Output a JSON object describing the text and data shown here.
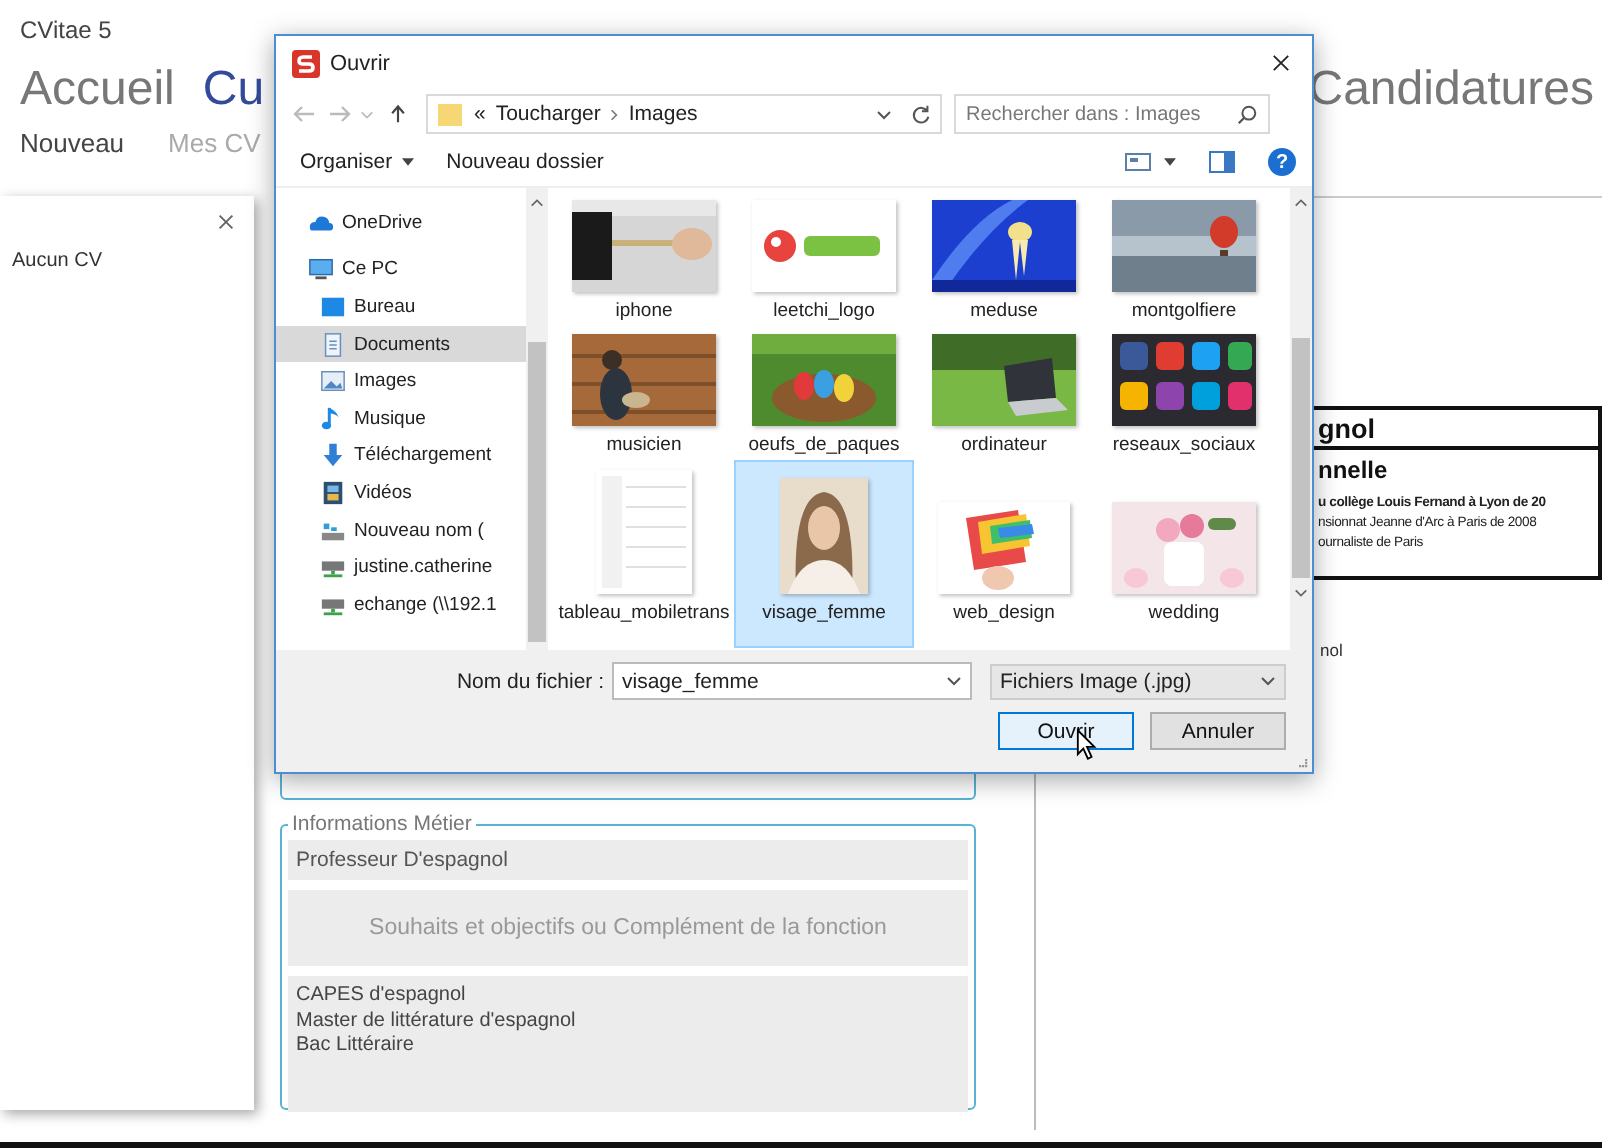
{
  "app": {
    "title": "CVitae 5",
    "nav": [
      {
        "label": "Accueil",
        "selected": false
      },
      {
        "label": "Cu",
        "selected": true
      },
      {
        "label": "Candidatures",
        "selected": false
      }
    ],
    "subnav": [
      {
        "label": "Nouveau",
        "selected": true
      },
      {
        "label": "Mes CV",
        "selected": false
      }
    ]
  },
  "cv_list": {
    "empty_text": "Aucun CV"
  },
  "form": {
    "legend": "Informations Métier",
    "job_title": "Professeur D'espagnol",
    "goals_placeholder": "Souhaits et objectifs ou Complément de la fonction",
    "diplomas": [
      "CAPES d'espagnol",
      "Master de littérature d'espagnol",
      "Bac Littéraire"
    ]
  },
  "preview": {
    "title": "gnol",
    "section_heading": "nnelle",
    "lines": [
      {
        "text": "u collège Louis Fernand à Lyon de 20",
        "bold": true
      },
      {
        "text": "nsionnat Jeanne d'Arc à Paris de 2008",
        "bold": false
      },
      {
        "text": "ournaliste de Paris",
        "bold": false
      }
    ],
    "footer_text": "nol"
  },
  "dialog": {
    "title": "Ouvrir",
    "path_prefix": "«",
    "path": [
      "Toucharger",
      "Images"
    ],
    "search_placeholder": "Rechercher dans : Images",
    "organize": "Organiser",
    "new_folder": "Nouveau dossier",
    "help": "?",
    "nav": [
      {
        "label": "OneDrive",
        "selected": false
      },
      {
        "label": "Ce PC",
        "selected": false,
        "children": [
          {
            "label": "Bureau",
            "selected": false
          },
          {
            "label": "Documents",
            "selected": true
          },
          {
            "label": "Images",
            "selected": false
          },
          {
            "label": "Musique",
            "selected": false
          },
          {
            "label": "Téléchargement",
            "selected": false
          },
          {
            "label": "Vidéos",
            "selected": false
          },
          {
            "label": "Nouveau nom (",
            "selected": false
          },
          {
            "label": "justine.catherine",
            "selected": false
          },
          {
            "label": "echange (\\\\192.1",
            "selected": false
          }
        ]
      }
    ],
    "files": [
      {
        "name": "iphone",
        "selected": false
      },
      {
        "name": "leetchi_logo",
        "selected": false
      },
      {
        "name": "meduse",
        "selected": false
      },
      {
        "name": "montgolfiere",
        "selected": false
      },
      {
        "name": "musicien",
        "selected": false
      },
      {
        "name": "oeufs_de_paques",
        "selected": false
      },
      {
        "name": "ordinateur",
        "selected": false
      },
      {
        "name": "reseaux_sociaux",
        "selected": false
      },
      {
        "name": "tableau_mobiletrans",
        "selected": false
      },
      {
        "name": "visage_femme",
        "selected": true
      },
      {
        "name": "web_design",
        "selected": false
      },
      {
        "name": "wedding",
        "selected": false
      }
    ],
    "filename_label": "Nom du fichier :",
    "filename": "visage_femme",
    "filter": "Fichiers Image (.jpg)",
    "buttons": [
      {
        "label": "Ouvrir",
        "kind": "primary"
      },
      {
        "label": "Annuler",
        "kind": "secondary"
      }
    ]
  }
}
